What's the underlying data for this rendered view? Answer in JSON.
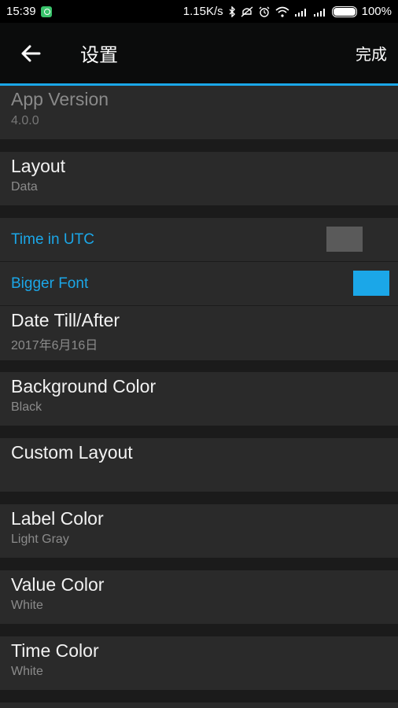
{
  "status_bar": {
    "time": "15:39",
    "speed": "1.15K/s",
    "battery": "100%",
    "icons": [
      "app-notification-icon",
      "bluetooth-icon",
      "mute-icon",
      "alarm-icon",
      "wifi-icon",
      "signal-icon",
      "signal-icon",
      "battery-icon"
    ]
  },
  "action_bar": {
    "title": "设置",
    "done_label": "完成",
    "back_icon": "arrow-left-icon"
  },
  "colors": {
    "accent": "#1ba7e8",
    "toggle_off": "#5a5a5a",
    "toggle_on": "#1ba7e8"
  },
  "settings": {
    "app_version": {
      "label": "App Version",
      "value": "4.0.0"
    },
    "layout": {
      "label": "Layout",
      "value": "Data"
    },
    "time_utc": {
      "label": "Time in UTC",
      "checked": false
    },
    "bigger_font": {
      "label": "Bigger Font",
      "checked": true
    },
    "date_till": {
      "label": "Date Till/After",
      "value": "2017年6月16日"
    },
    "background_color": {
      "label": "Background Color",
      "value": "Black"
    },
    "custom_layout": {
      "label": "Custom Layout"
    },
    "label_color": {
      "label": "Label Color",
      "value": "Light Gray"
    },
    "value_color": {
      "label": "Value Color",
      "value": "White"
    },
    "time_color": {
      "label": "Time Color",
      "value": "White"
    }
  }
}
